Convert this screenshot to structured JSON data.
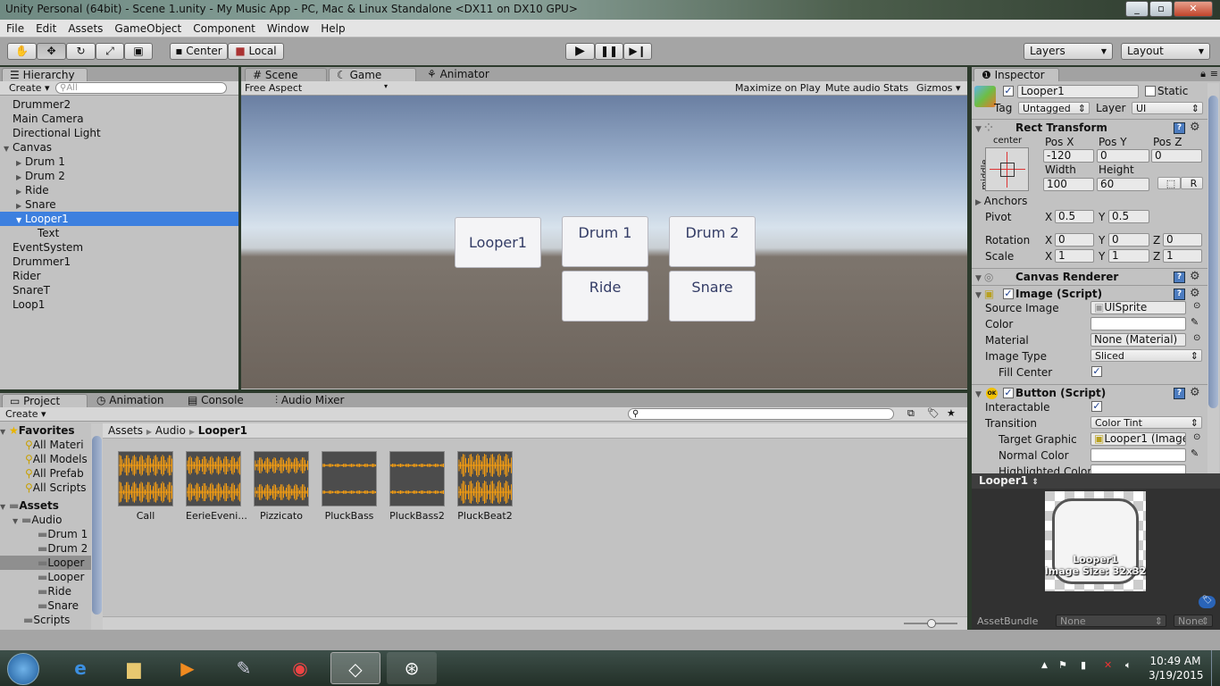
{
  "window": {
    "title": "Unity Personal (64bit) - Scene 1.unity - My Music App - PC, Mac & Linux Standalone <DX11 on DX10 GPU>"
  },
  "menu": [
    "File",
    "Edit",
    "Assets",
    "GameObject",
    "Component",
    "Window",
    "Help"
  ],
  "toolbar": {
    "pivot": "Center",
    "space": "Local",
    "layers": "Layers",
    "layout": "Layout"
  },
  "hierarchy": {
    "tab": "Hierarchy",
    "create": "Create",
    "search_placeholder": "All",
    "items": [
      {
        "label": "Drummer2",
        "indent": 0,
        "arrow": ""
      },
      {
        "label": "Main Camera",
        "indent": 0,
        "arrow": ""
      },
      {
        "label": "Directional Light",
        "indent": 0,
        "arrow": ""
      },
      {
        "label": "Canvas",
        "indent": 0,
        "arrow": "▼"
      },
      {
        "label": "Drum 1",
        "indent": 1,
        "arrow": "▶"
      },
      {
        "label": "Drum 2",
        "indent": 1,
        "arrow": "▶"
      },
      {
        "label": "Ride",
        "indent": 1,
        "arrow": "▶"
      },
      {
        "label": "Snare",
        "indent": 1,
        "arrow": "▶"
      },
      {
        "label": "Looper1",
        "indent": 1,
        "arrow": "▼",
        "selected": true
      },
      {
        "label": "Text",
        "indent": 2,
        "arrow": ""
      },
      {
        "label": "EventSystem",
        "indent": 0,
        "arrow": ""
      },
      {
        "label": "Drummer1",
        "indent": 0,
        "arrow": ""
      },
      {
        "label": "Rider",
        "indent": 0,
        "arrow": ""
      },
      {
        "label": "SnareT",
        "indent": 0,
        "arrow": ""
      },
      {
        "label": "Loop1",
        "indent": 0,
        "arrow": ""
      }
    ]
  },
  "scene_tabs": {
    "scene": "Scene",
    "game": "Game",
    "animator": "Animator"
  },
  "game": {
    "aspect": "Free Aspect",
    "maximize": "Maximize on Play",
    "mute": "Mute audio",
    "stats": "Stats",
    "gizmos": "Gizmos",
    "buttons": {
      "looper1": "Looper1",
      "drum1": "Drum 1",
      "drum2": "Drum 2",
      "ride": "Ride",
      "snare": "Snare"
    }
  },
  "inspector": {
    "tab": "Inspector",
    "name": "Looper1",
    "static": "Static",
    "tag_label": "Tag",
    "tag": "Untagged",
    "layer_label": "Layer",
    "layer": "UI",
    "rect": {
      "title": "Rect Transform",
      "anchor_h": "center",
      "anchor_v": "middle",
      "posx_l": "Pos X",
      "posy_l": "Pos Y",
      "posz_l": "Pos Z",
      "posx": "-120",
      "posy": "0",
      "posz": "0",
      "width_l": "Width",
      "height_l": "Height",
      "width": "100",
      "height": "60",
      "r": "R",
      "anchors": "Anchors",
      "pivot": "Pivot",
      "pivot_x": "0.5",
      "pivot_y": "0.5",
      "rotation": "Rotation",
      "rot_x": "0",
      "rot_y": "0",
      "rot_z": "0",
      "scale": "Scale",
      "scale_x": "1",
      "scale_y": "1",
      "scale_z": "1",
      "x": "X",
      "y": "Y",
      "z": "Z"
    },
    "canvas_renderer": "Canvas Renderer",
    "image": {
      "title": "Image (Script)",
      "source_l": "Source Image",
      "source": "UISprite",
      "color_l": "Color",
      "material_l": "Material",
      "material": "None (Material)",
      "type_l": "Image Type",
      "type": "Sliced",
      "fill_l": "Fill Center"
    },
    "button": {
      "title": "Button (Script)",
      "ok": "OK",
      "interactable_l": "Interactable",
      "transition_l": "Transition",
      "transition": "Color Tint",
      "target_l": "Target Graphic",
      "target": "Looper1 (Image",
      "normal_l": "Normal Color",
      "highlighted_l": "Highlighted Color"
    }
  },
  "preview": {
    "title": "Looper1",
    "caption": "Looper1",
    "size": "Image Size: 32x32",
    "assetbundle": "AssetBundle",
    "bundle": "None",
    "variant": "None"
  },
  "project": {
    "tabs": [
      "Project",
      "Animation",
      "Console",
      "Audio Mixer"
    ],
    "create": "Create",
    "favorites": "Favorites",
    "fav_items": [
      "All Materi",
      "All Models",
      "All Prefab",
      "All Scripts"
    ],
    "assets": "Assets",
    "audio": "Audio",
    "folders": [
      "Drum 1",
      "Drum 2",
      "Looper",
      "Looper",
      "Ride",
      "Snare"
    ],
    "scripts": "Scripts",
    "breadcrumb": [
      "Assets",
      "Audio",
      "Looper1"
    ],
    "files": [
      "Call",
      "EerieEveni...",
      "Pizzicato",
      "PluckBass",
      "PluckBass2",
      "PluckBeat2"
    ]
  },
  "colors": {
    "selection": "#3d80df",
    "waveform": "#f39c12",
    "panel": "#c2c2c2"
  },
  "taskbar": {
    "time": "10:49 AM",
    "date": "3/19/2015"
  }
}
